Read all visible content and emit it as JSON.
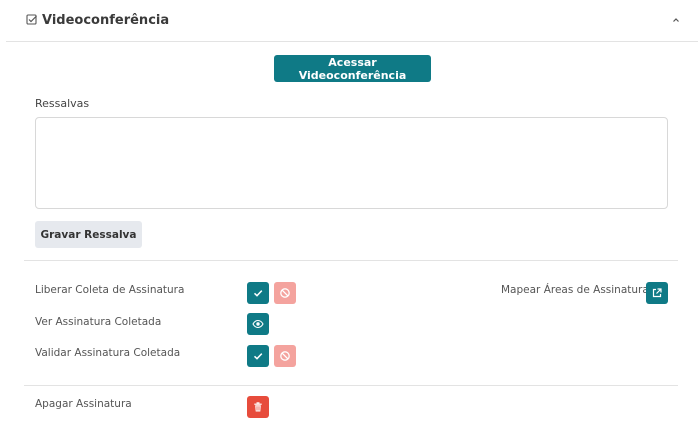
{
  "header": {
    "title": "Videoconferência",
    "title_icon": "checkbox-icon",
    "collapse_icon": "chevron-up-icon"
  },
  "video": {
    "access_button": "Acessar Videoconferência"
  },
  "ressalvas": {
    "label": "Ressalvas",
    "value": "",
    "save_button": "Gravar Ressalva"
  },
  "signature": {
    "release_label": "Liberar Coleta de Assinatura",
    "view_label": "Ver Assinatura Coletada",
    "validate_label": "Validar Assinatura Coletada",
    "map_label": "Mapear Áreas de Assinatura",
    "delete_label": "Apagar Assinatura"
  },
  "colors": {
    "primary": "#0f7a86",
    "deny": "#f4a39e",
    "danger": "#e74c3c",
    "secondary": "#e6e9ee"
  }
}
